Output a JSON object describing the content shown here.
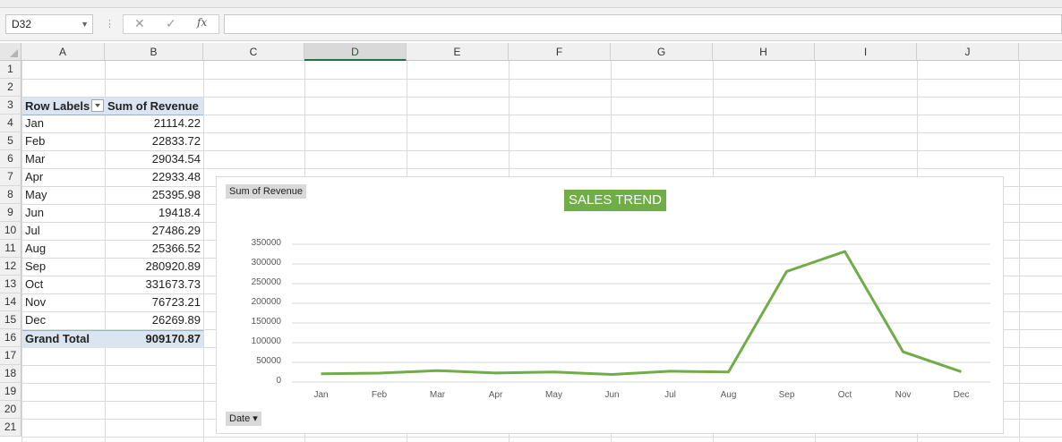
{
  "formula_bar": {
    "name_box": "D32",
    "cancel_icon": "✕",
    "enter_icon": "✓",
    "fx_icon": "fx",
    "formula": ""
  },
  "sheet": {
    "columns": [
      "A",
      "B",
      "C",
      "D",
      "E",
      "F",
      "G",
      "H",
      "I",
      "J"
    ],
    "selected_column": "D",
    "rows": [
      "1",
      "2",
      "3",
      "4",
      "5",
      "6",
      "7",
      "8",
      "9",
      "10",
      "11",
      "12",
      "13",
      "14",
      "15",
      "16",
      "17",
      "18",
      "19",
      "20",
      "21"
    ]
  },
  "pivot": {
    "row_labels_header": "Row Labels",
    "values_header": "Sum of Revenue",
    "rows": [
      {
        "label": "Jan",
        "value": "21114.22"
      },
      {
        "label": "Feb",
        "value": "22833.72"
      },
      {
        "label": "Mar",
        "value": "29034.54"
      },
      {
        "label": "Apr",
        "value": "22933.48"
      },
      {
        "label": "May",
        "value": "25395.98"
      },
      {
        "label": "Jun",
        "value": "19418.4"
      },
      {
        "label": "Jul",
        "value": "27486.29"
      },
      {
        "label": "Aug",
        "value": "25366.52"
      },
      {
        "label": "Sep",
        "value": "280920.89"
      },
      {
        "label": "Oct",
        "value": "331673.73"
      },
      {
        "label": "Nov",
        "value": "76723.21"
      },
      {
        "label": "Dec",
        "value": "26269.89"
      }
    ],
    "total_label": "Grand Total",
    "total_value": "909170.87"
  },
  "chart_data": {
    "type": "line",
    "title": "SALES TREND",
    "value_field_button": "Sum of Revenue",
    "axis_field_button": "Date ▾",
    "categories": [
      "Jan",
      "Feb",
      "Mar",
      "Apr",
      "May",
      "Jun",
      "Jul",
      "Aug",
      "Sep",
      "Oct",
      "Nov",
      "Dec"
    ],
    "values": [
      21114.22,
      22833.72,
      29034.54,
      22933.48,
      25395.98,
      19418.4,
      27486.29,
      25366.52,
      280920.89,
      331673.73,
      76723.21,
      26269.89
    ],
    "yticks": [
      "0",
      "50000",
      "100000",
      "150000",
      "200000",
      "250000",
      "300000",
      "350000"
    ],
    "ylim": [
      0,
      350000
    ],
    "grid": true,
    "legend": "none",
    "line_color": "#70ad47"
  }
}
